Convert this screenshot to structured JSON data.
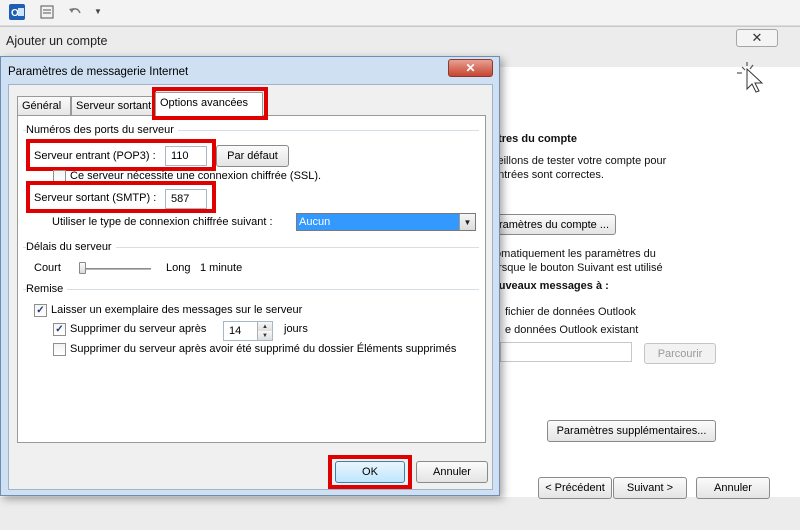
{
  "qat": {
    "outlook_icon": "outlook-icon",
    "sendreceive_icon": "send-receive-icon",
    "undo_icon": "undo-icon",
    "customize_icon": "customize-icon"
  },
  "bg_window": {
    "title": "Ajouter un compte",
    "close_label": "✕",
    "heading": "Tester les paramètres du compte",
    "heading_visible": "ètres du compte",
    "line1": "seillons de tester votre compte pour",
    "line2": "entrées sont correctes.",
    "test_button": "paramètres du compte ...",
    "auto_line1": "tomatiquement les paramètres du",
    "auto_line2": "orsque le bouton Suivant est utilisé",
    "new_messages": "ouveaux messages à :",
    "outlook_file": "fichier de données Outlook",
    "existing_file": "e données Outlook existant",
    "browse_button": "Parcourir",
    "more_settings_button": "Paramètres supplémentaires...",
    "prev_button": "< Précédent",
    "next_button": "Suivant >",
    "cancel_button": "Annuler"
  },
  "dialog": {
    "title": "Paramètres de messagerie Internet",
    "close_label": "✕",
    "tabs": [
      {
        "label": "Général"
      },
      {
        "label": "Serveur sortant"
      },
      {
        "label": "Options avancées"
      }
    ],
    "ports_group": "Numéros des ports du serveur",
    "incoming_label": "Serveur entrant (POP3) :",
    "incoming_value": "110",
    "default_button": "Par défaut",
    "ssl_label": "Ce serveur nécessite une connexion chiffrée (SSL).",
    "ssl_checked": false,
    "outgoing_label": "Serveur sortant (SMTP) :",
    "outgoing_value": "587",
    "encryption_label": "Utiliser le type de connexion chiffrée suivant :",
    "encryption_value": "Aucun",
    "timeout_group": "Délais du serveur",
    "timeout_short": "Court",
    "timeout_long": "Long",
    "timeout_value": "1 minute",
    "delivery_group": "Remise",
    "leave_copy_label": "Laisser un exemplaire des messages sur le serveur",
    "leave_copy_checked": true,
    "remove_after_label": "Supprimer du serveur après",
    "remove_after_checked": true,
    "remove_after_days": "14",
    "days_label": "jours",
    "remove_deleted_label": "Supprimer du serveur après avoir été supprimé du dossier Éléments supprimés",
    "remove_deleted_checked": false,
    "ok_button": "OK",
    "cancel_button": "Annuler"
  },
  "colors": {
    "highlight": "#e00000",
    "select_blue": "#3399ff"
  }
}
